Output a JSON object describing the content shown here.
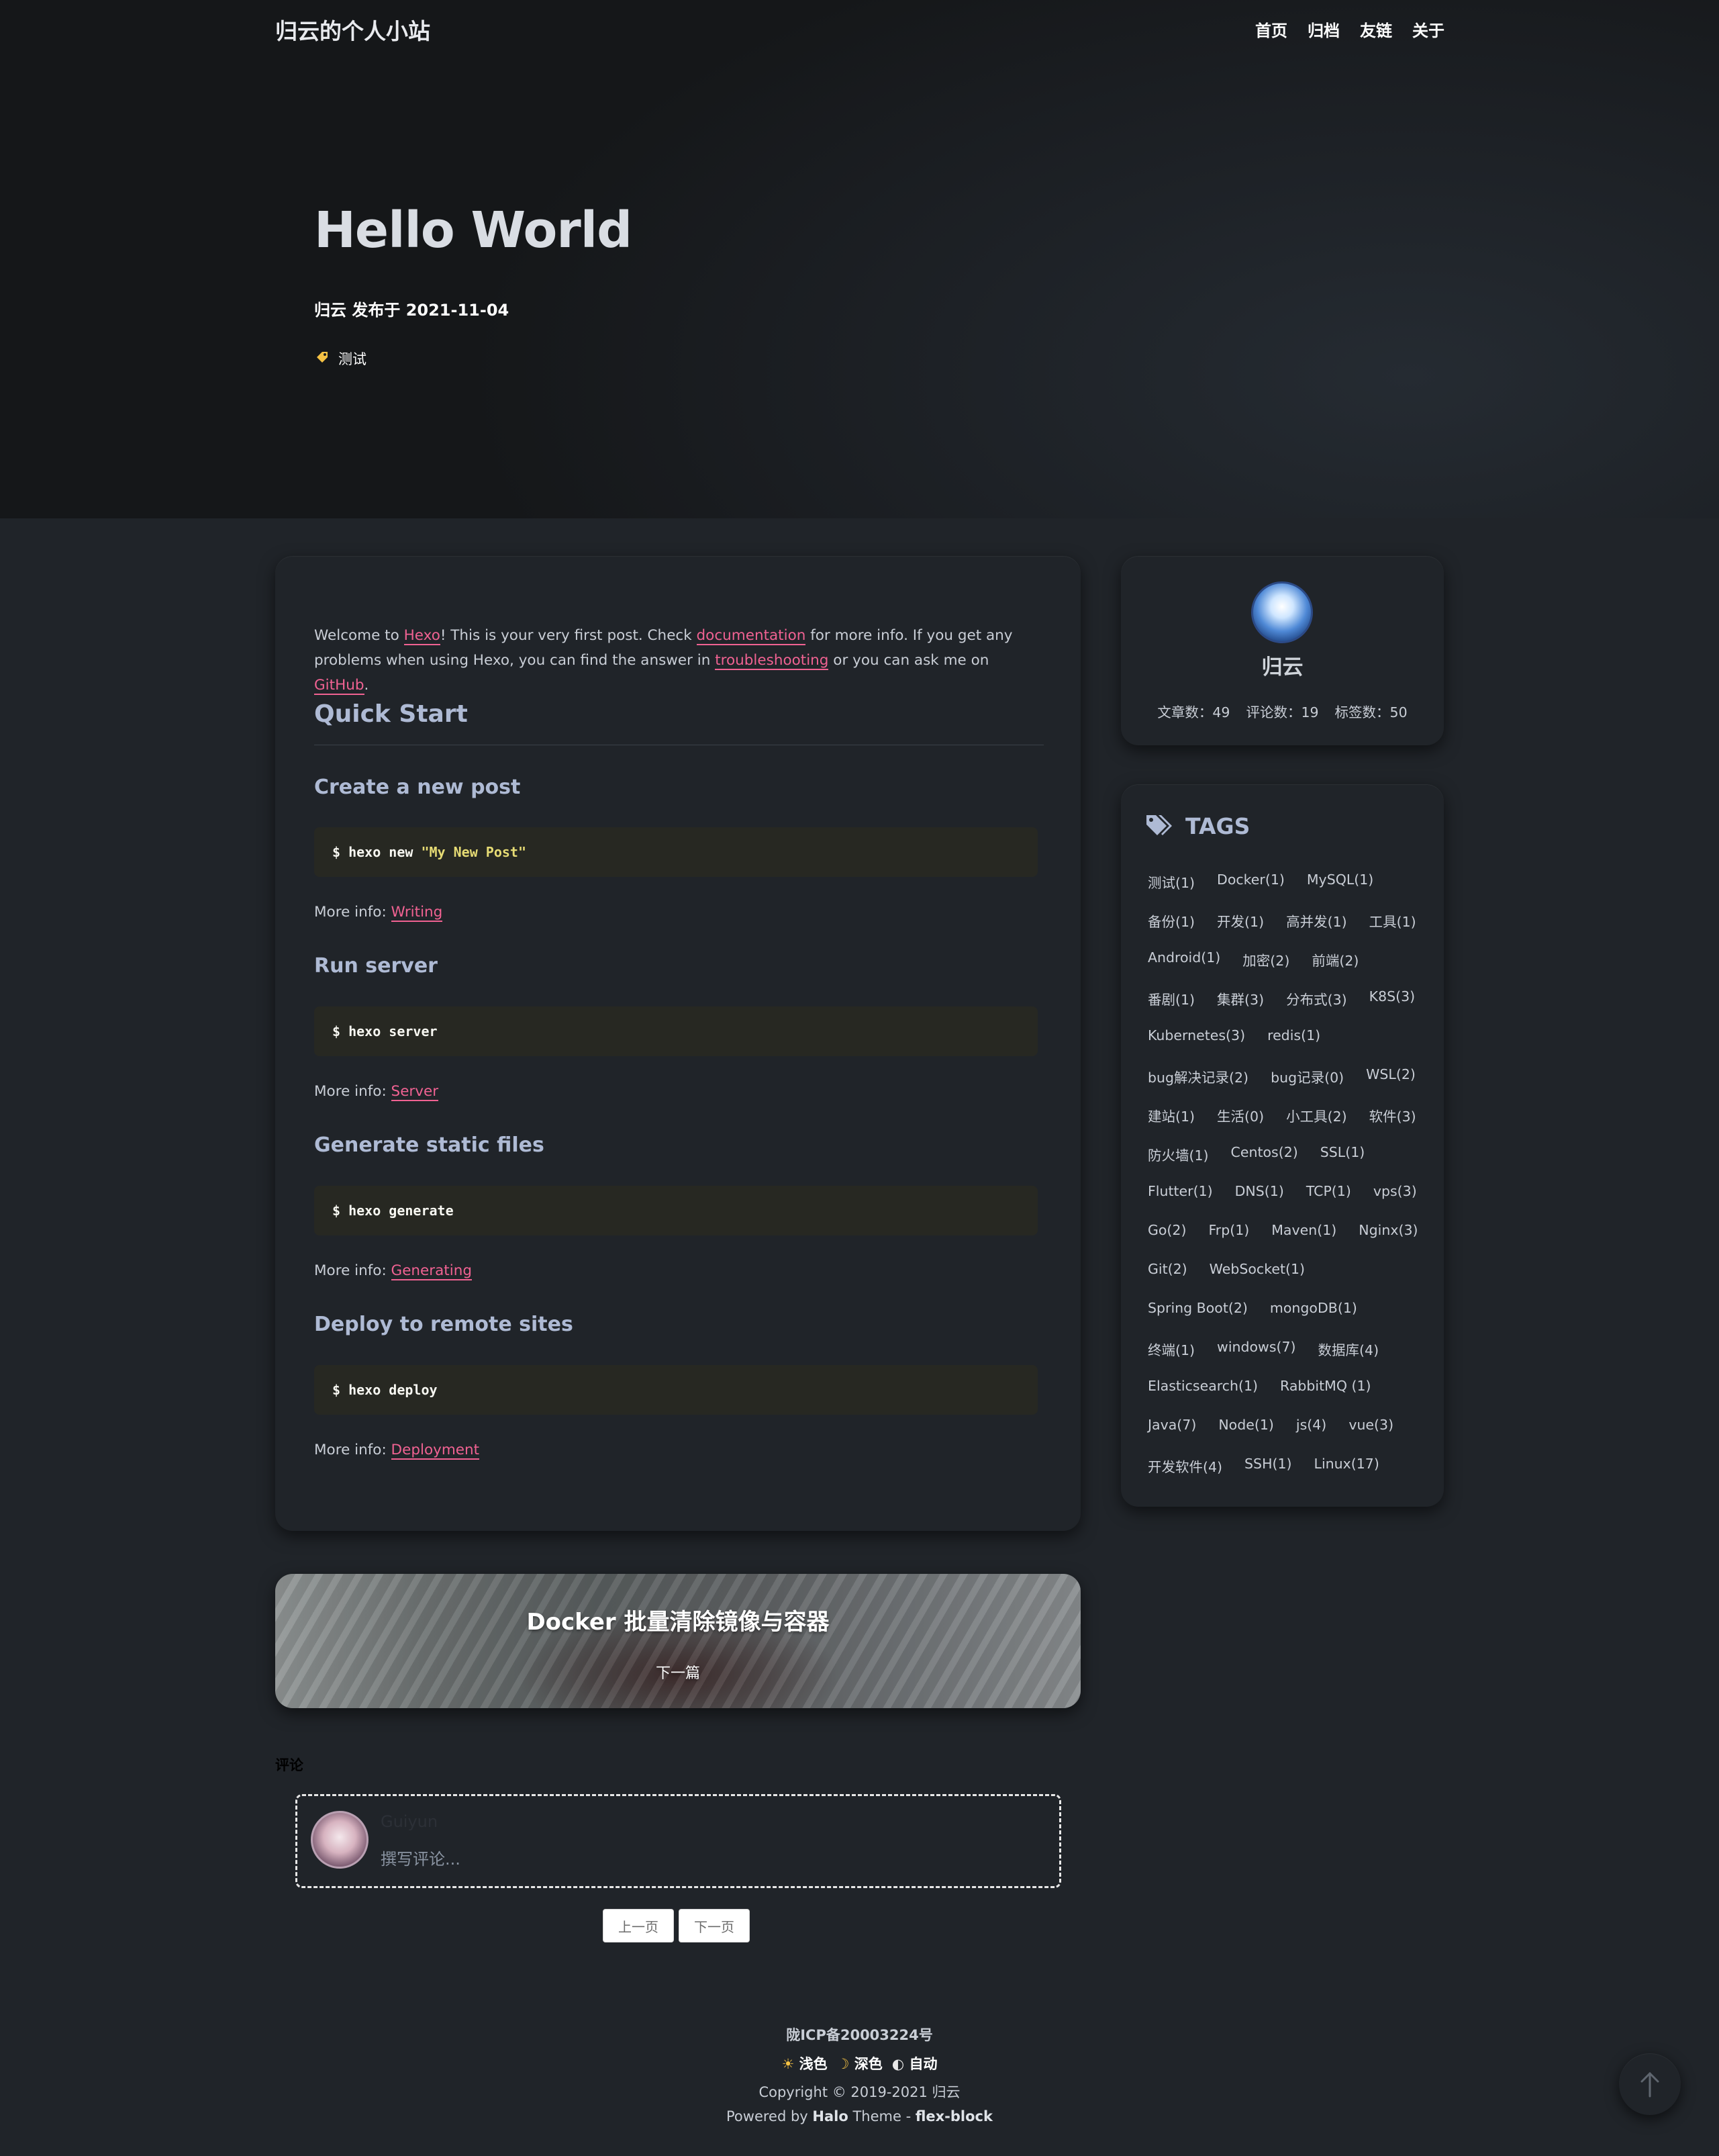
{
  "header": {
    "site_title": "归云的个人小站",
    "nav": [
      "首页",
      "归档",
      "友链",
      "关于"
    ]
  },
  "hero": {
    "title": "Hello World",
    "meta": "归云 发布于 2021-11-04",
    "tag": "测试",
    "tag_icon": "tag-icon"
  },
  "article": {
    "intro": {
      "t1": "Welcome to ",
      "l1": "Hexo",
      "t2": "! This is your very first post. Check ",
      "l2": "documentation",
      "t3": " for more info. If you get any problems when using Hexo, you can find the answer in ",
      "l3": "troubleshooting",
      "t4": " or you can ask me on ",
      "l4": "GitHub",
      "t5": "."
    },
    "quick_start": "Quick Start",
    "more_prefix": "More info: ",
    "sections": [
      {
        "title": "Create a new post",
        "cmd": "$ hexo new ",
        "cmd_str": "\"My New Post\"",
        "link": "Writing"
      },
      {
        "title": "Run server",
        "cmd": "$ hexo server",
        "cmd_str": "",
        "link": "Server"
      },
      {
        "title": "Generate static files",
        "cmd": "$ hexo generate",
        "cmd_str": "",
        "link": "Generating"
      },
      {
        "title": "Deploy to remote sites",
        "cmd": "$ hexo deploy",
        "cmd_str": "",
        "link": "Deployment"
      }
    ],
    "link_color": "#f06292"
  },
  "profile": {
    "name": "归云",
    "posts": "文章数：49",
    "comments": "评论数：19",
    "tags": "标签数：50"
  },
  "tags_widget": {
    "title": "TAGS",
    "rows": [
      [
        "测试(1)",
        "Docker(1)",
        "MySQL(1)"
      ],
      [
        "备份(1)",
        "开发(1)",
        "高并发(1)",
        "工具(1)"
      ],
      [
        "Android(1)",
        "加密(2)",
        "前端(2)"
      ],
      [
        "番剧(1)",
        "集群(3)",
        "分布式(3)",
        "K8S(3)"
      ],
      [
        "Kubernetes(3)",
        "redis(1)"
      ],
      [
        "bug解决记录(2)",
        "bug记录(0)",
        "WSL(2)"
      ],
      [
        "建站(1)",
        "生活(0)",
        "小工具(2)",
        "软件(3)"
      ],
      [
        "防火墙(1)",
        "Centos(2)",
        "SSL(1)"
      ],
      [
        "Flutter(1)",
        "DNS(1)",
        "TCP(1)",
        "vps(3)"
      ],
      [
        "Go(2)",
        "Frp(1)",
        "Maven(1)",
        "Nginx(3)"
      ],
      [
        "Git(2)",
        "WebSocket(1)"
      ],
      [
        "Spring Boot(2)",
        "mongoDB(1)"
      ],
      [
        "终端(1)",
        "windows(7)",
        "数据库(4)"
      ],
      [
        "Elasticsearch(1)",
        "RabbitMQ (1)"
      ],
      [
        "Java(7)",
        "Node(1)",
        "js(4)",
        "vue(3)"
      ],
      [
        "开发软件(4)",
        "SSH(1)",
        "Linux(17)"
      ]
    ]
  },
  "next_post": {
    "title": "Docker 批量清除镜像与容器",
    "label": "下一篇"
  },
  "comments": {
    "label": "评论",
    "name_placeholder": "Guiyun",
    "input_placeholder": "撰写评论...",
    "prev": "上一页",
    "next": "下一页"
  },
  "footer": {
    "icp": "陇ICP备20003224号",
    "theme_light": "浅色",
    "theme_dark": "深色",
    "theme_auto": "自动",
    "copyright": "Copyright © 2019-2021 归云",
    "powered_prefix": "Powered by ",
    "powered_halo": "Halo",
    "powered_mid": " Theme - ",
    "powered_theme": "flex-block"
  }
}
